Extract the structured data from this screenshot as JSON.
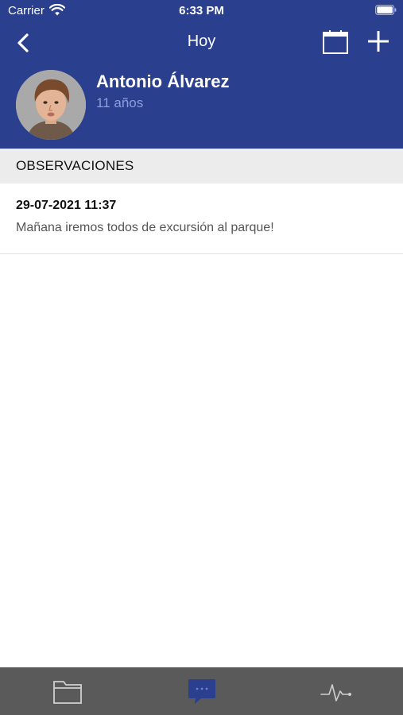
{
  "status_bar": {
    "carrier": "Carrier",
    "time": "6:33 PM"
  },
  "nav": {
    "title": "Hoy",
    "back_icon": "chevron-left-icon",
    "calendar_icon": "calendar-icon",
    "add_icon": "plus-icon"
  },
  "profile": {
    "name": "Antonio Álvarez",
    "age": "11 años"
  },
  "section": {
    "title": "OBSERVACIONES"
  },
  "observations": [
    {
      "date": "29-07-2021 11:37",
      "text": "Mañana iremos todos de excursión al parque!"
    }
  ],
  "tabbar": {
    "tabs": [
      {
        "icon": "folder-icon",
        "active": false
      },
      {
        "icon": "chat-bubble-icon",
        "active": true
      },
      {
        "icon": "pulse-icon",
        "active": false
      }
    ]
  },
  "colors": {
    "header": "#2a3f8d",
    "age_text": "#8e9ee0",
    "section_bg": "#ececec",
    "tabbar_bg": "#5a5a5a",
    "active_tab": "#2a3f8d"
  }
}
